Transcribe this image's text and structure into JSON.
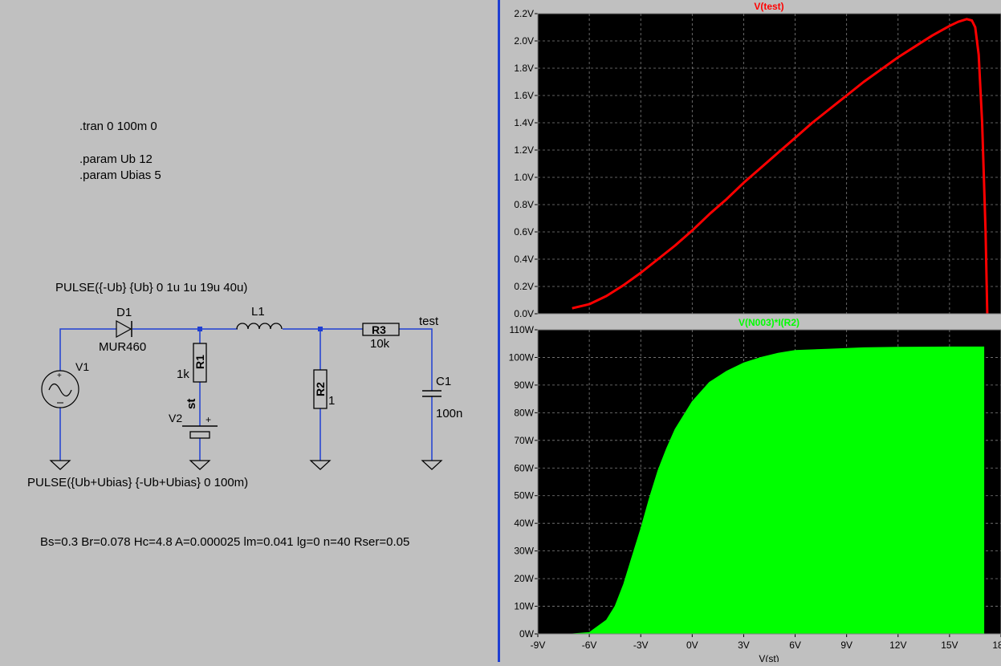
{
  "schematic": {
    "directives": [
      ".tran 0 100m 0",
      ".param Ub 12",
      ".param Ubias 5"
    ],
    "v1_source": "PULSE({-Ub} {Ub} 0 1u 1u 19u 40u)",
    "v2_source": "PULSE({Ub+Ubias} {-Ub+Ubias} 0 100m)",
    "inductor_model": "Bs=0.3 Br=0.078 Hc=4.8 A=0.000025 lm=0.041 lg=0 n=40 Rser=0.05",
    "components": {
      "d1_name": "D1",
      "d1_value": "MUR460",
      "l1_name": "L1",
      "r1_name": "R1",
      "r1_value": "1k",
      "r2_name": "R2",
      "r2_value": "1",
      "r3_name": "R3",
      "r3_value": "10k",
      "c1_name": "C1",
      "c1_value": "100n",
      "v1_name": "V1",
      "v2_name": "V2",
      "net_st": "st",
      "net_test": "test",
      "plus": "+"
    }
  },
  "colors": {
    "background": "#000000",
    "grid": "#808080",
    "trace_top": "#ff0000",
    "trace_bottom": "#00ff00",
    "wire": "#1f3fd2",
    "window_bg": "#c0c0c0"
  },
  "chart_data": [
    {
      "type": "line",
      "title": "V(test)",
      "xlim": [
        -9,
        18
      ],
      "ylim": [
        0,
        2.2
      ],
      "x_ticks": [
        -9,
        -6,
        -3,
        0,
        3,
        6,
        9,
        12,
        15,
        18
      ],
      "y_ticks": [
        0.0,
        0.2,
        0.4,
        0.6,
        0.8,
        1.0,
        1.2,
        1.4,
        1.6,
        1.8,
        2.0,
        2.2
      ],
      "y_tick_labels": [
        "0.0V",
        "0.2V",
        "0.4V",
        "0.6V",
        "0.8V",
        "1.0V",
        "1.2V",
        "1.4V",
        "1.6V",
        "1.8V",
        "2.0V",
        "2.2V"
      ],
      "grid": true,
      "series": [
        {
          "color": "#ff0000",
          "x": [
            -7.0,
            -6.0,
            -5.0,
            -4.0,
            -3.0,
            -2.0,
            -1.0,
            0.0,
            1.0,
            2.0,
            3.0,
            4.0,
            5.0,
            6.0,
            7.0,
            8.0,
            9.0,
            10.0,
            11.0,
            12.0,
            13.0,
            14.0,
            15.0,
            15.5,
            16.0,
            16.3,
            16.5,
            16.7,
            16.9,
            17.1,
            17.2
          ],
          "y": [
            0.04,
            0.07,
            0.13,
            0.21,
            0.3,
            0.4,
            0.5,
            0.61,
            0.73,
            0.84,
            0.96,
            1.07,
            1.18,
            1.29,
            1.4,
            1.5,
            1.6,
            1.7,
            1.79,
            1.88,
            1.96,
            2.04,
            2.11,
            2.14,
            2.16,
            2.15,
            2.1,
            1.9,
            1.4,
            0.6,
            0.0
          ]
        }
      ]
    },
    {
      "type": "area",
      "title": "V(N003)*I(R2)",
      "xlabel": "V(st)",
      "xlim": [
        -9,
        18
      ],
      "ylim": [
        0,
        110
      ],
      "x_ticks": [
        -9,
        -6,
        -3,
        0,
        3,
        6,
        9,
        12,
        15,
        18
      ],
      "x_tick_labels": [
        "-9V",
        "-6V",
        "-3V",
        "0V",
        "3V",
        "6V",
        "9V",
        "12V",
        "15V",
        "18V"
      ],
      "y_ticks": [
        0,
        10,
        20,
        30,
        40,
        50,
        60,
        70,
        80,
        90,
        100,
        110
      ],
      "y_tick_labels": [
        "0W",
        "10W",
        "20W",
        "30W",
        "40W",
        "50W",
        "60W",
        "70W",
        "80W",
        "90W",
        "100W",
        "110W"
      ],
      "grid": true,
      "series": [
        {
          "color": "#00ff00",
          "x": [
            -9.0,
            -7.0,
            -6.0,
            -5.0,
            -4.5,
            -4.0,
            -3.5,
            -3.0,
            -2.5,
            -2.0,
            -1.5,
            -1.0,
            0.0,
            1.0,
            2.0,
            3.0,
            4.0,
            5.0,
            6.0,
            8.0,
            10.0,
            12.0,
            15.0,
            17.0
          ],
          "y": [
            0,
            0,
            0.5,
            5,
            10,
            18,
            28,
            38,
            49,
            59,
            67,
            74,
            84,
            91,
            95,
            98,
            100,
            101.5,
            102.5,
            103,
            103.5,
            103.7,
            103.8,
            103.8
          ]
        }
      ]
    }
  ]
}
